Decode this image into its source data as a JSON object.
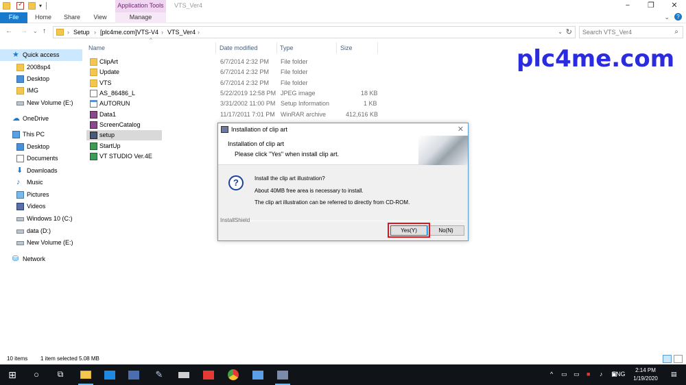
{
  "window": {
    "title": "VTS_Ver4",
    "context_tab": "Application Tools"
  },
  "ribbon": {
    "tabs": [
      "File",
      "Home",
      "Share",
      "View",
      "Manage"
    ]
  },
  "address": {
    "crumbs": [
      "Setup",
      "[plc4me.com]VTS-V4",
      "VTS_Ver4"
    ],
    "separator": "›"
  },
  "search": {
    "placeholder": "Search VTS_Ver4"
  },
  "nav": {
    "items": [
      {
        "label": "Quick access",
        "icon": "star-icon"
      },
      {
        "label": "2008sp4",
        "icon": "folder-icon"
      },
      {
        "label": "Desktop",
        "icon": "desktop-icon"
      },
      {
        "label": "IMG",
        "icon": "folder-icon"
      },
      {
        "label": "New Volume (E:)",
        "icon": "drive-icon"
      },
      {
        "label": "OneDrive",
        "icon": "cloud-icon"
      },
      {
        "label": "This PC",
        "icon": "pc-icon"
      },
      {
        "label": "Desktop",
        "icon": "desktop-icon"
      },
      {
        "label": "Documents",
        "icon": "documents-icon"
      },
      {
        "label": "Downloads",
        "icon": "downloads-icon"
      },
      {
        "label": "Music",
        "icon": "music-icon"
      },
      {
        "label": "Pictures",
        "icon": "pictures-icon"
      },
      {
        "label": "Videos",
        "icon": "videos-icon"
      },
      {
        "label": "Windows 10 (C:)",
        "icon": "drive-icon"
      },
      {
        "label": "data (D:)",
        "icon": "drive-icon"
      },
      {
        "label": "New Volume (E:)",
        "icon": "drive-icon"
      },
      {
        "label": "Network",
        "icon": "network-icon"
      }
    ]
  },
  "columns": {
    "name": "Name",
    "date": "Date modified",
    "type": "Type",
    "size": "Size"
  },
  "files": [
    {
      "name": "ClipArt",
      "date": "6/7/2014 2:32 PM",
      "type": "File folder",
      "size": "",
      "icon": "folder"
    },
    {
      "name": "Update",
      "date": "6/7/2014 2:32 PM",
      "type": "File folder",
      "size": "",
      "icon": "folder"
    },
    {
      "name": "VTS",
      "date": "6/7/2014 2:32 PM",
      "type": "File folder",
      "size": "",
      "icon": "folder"
    },
    {
      "name": "AS_86486_L",
      "date": "5/22/2019 12:58 PM",
      "type": "JPEG image",
      "size": "18 KB",
      "icon": "img"
    },
    {
      "name": "AUTORUN",
      "date": "3/31/2002 11:00 PM",
      "type": "Setup Information",
      "size": "1 KB",
      "icon": "inf"
    },
    {
      "name": "Data1",
      "date": "11/17/2011 7:01 PM",
      "type": "WinRAR archive",
      "size": "412,616 KB",
      "icon": "rar"
    },
    {
      "name": "ScreenCatalog",
      "date": "",
      "type": "",
      "size": "",
      "icon": "rar"
    },
    {
      "name": "setup",
      "date": "",
      "type": "",
      "size": "",
      "icon": "exe"
    },
    {
      "name": "StartUp",
      "date": "",
      "type": "",
      "size": "",
      "icon": "app"
    },
    {
      "name": "VT STUDIO Ver.4E",
      "date": "",
      "type": "",
      "size": "",
      "icon": "app"
    }
  ],
  "brand": "plc4me.com",
  "dialog": {
    "title": "Installation of clip art",
    "heading": "Installation of clip art",
    "subheading": "Please click \"Yes\" when install clip art.",
    "question": "Install the clip art illustration?",
    "line1": "About 40MB free area is necessary to install.",
    "line2": "The clip art illustration can be referred to directly from CD-ROM.",
    "footer": "InstallShield",
    "yes": "Yes(Y)",
    "no": "No(N)"
  },
  "status": {
    "count": "10 items",
    "selected": "1 item selected  5.08 MB"
  },
  "taskbar": {
    "lang": "ENG",
    "time": "2:14 PM",
    "date": "1/19/2020"
  }
}
